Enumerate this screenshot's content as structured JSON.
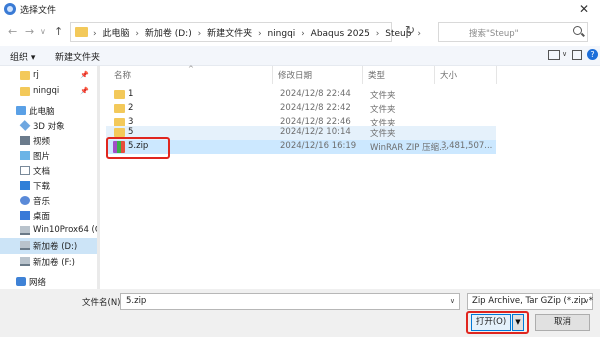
{
  "window": {
    "title": "选择文件",
    "close_glyph": "✕"
  },
  "nav": {
    "back": "←",
    "forward": "→",
    "recent": "∨",
    "up": "↑"
  },
  "address": {
    "crumbs": [
      "此电脑",
      "新加卷 (D:)",
      "新建文件夹",
      "ningqi",
      "Abaqus 2025",
      "Steup"
    ],
    "separator": "›",
    "chevron": "∨",
    "refresh": "↻"
  },
  "search": {
    "placeholder": "搜索\"Steup\""
  },
  "toolbar": {
    "organize": "组织 ▾",
    "new_folder": "新建文件夹",
    "help": "?"
  },
  "sidebar": {
    "pin": "📌",
    "items": [
      {
        "label": "rj",
        "icon": "folder-icon",
        "pinned": true
      },
      {
        "label": "ningqi",
        "icon": "folder-icon",
        "pinned": true
      },
      {
        "label": "此电脑",
        "icon": "pc-icon"
      },
      {
        "label": "3D 对象",
        "icon": "cube-icon"
      },
      {
        "label": "视频",
        "icon": "video-icon"
      },
      {
        "label": "图片",
        "icon": "picture-icon"
      },
      {
        "label": "文档",
        "icon": "document-icon"
      },
      {
        "label": "下载",
        "icon": "download-icon"
      },
      {
        "label": "音乐",
        "icon": "music-icon"
      },
      {
        "label": "桌面",
        "icon": "desktop-icon"
      },
      {
        "label": "Win10Prox64 (C",
        "icon": "drive-icon"
      },
      {
        "label": "新加卷 (D:)",
        "icon": "drive-icon",
        "selected": true
      },
      {
        "label": "新加卷 (F:)",
        "icon": "drive-icon"
      },
      {
        "label": "网络",
        "icon": "network-icon"
      }
    ]
  },
  "columns": {
    "name": "名称",
    "date": "修改日期",
    "type": "类型",
    "size": "大小"
  },
  "files": [
    {
      "name": "1",
      "date": "2024/12/8 22:44",
      "type": "文件夹",
      "size": ""
    },
    {
      "name": "2",
      "date": "2024/12/8 22:42",
      "type": "文件夹",
      "size": ""
    },
    {
      "name": "3",
      "date": "2024/12/8 22:46",
      "type": "文件夹",
      "size": ""
    },
    {
      "name": "5",
      "date": "2024/12/2 10:14",
      "type": "文件夹",
      "size": ""
    },
    {
      "name": "5.zip",
      "date": "2024/12/16 16:19",
      "type": "WinRAR ZIP 压缩...",
      "size": "3,481,507..."
    }
  ],
  "filename": {
    "label": "文件名(N):",
    "value": "5.zip",
    "chevron": "∨"
  },
  "filter": {
    "value": "Zip Archive, Tar GZip (*.zip *",
    "chevron": "∨"
  },
  "buttons": {
    "open": "打开(O)",
    "open_split": "▼",
    "cancel": "取消"
  }
}
